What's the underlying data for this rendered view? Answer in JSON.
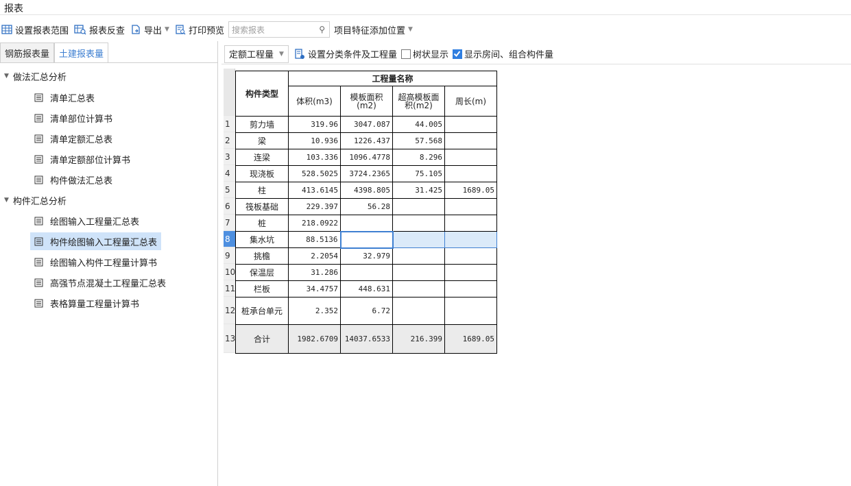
{
  "window": {
    "title": "报表"
  },
  "toolbar": {
    "set_range": "设置报表范围",
    "reverse_check": "报表反查",
    "export": "导出",
    "print_preview": "打印预览",
    "search_placeholder": "搜索报表",
    "feature_position": "项目特征添加位置"
  },
  "tabs": [
    {
      "label": "钢筋报表量",
      "active": false
    },
    {
      "label": "土建报表量",
      "active": true
    }
  ],
  "tree": {
    "groups": [
      {
        "label": "做法汇总分析",
        "items": [
          "清单汇总表",
          "清单部位计算书",
          "清单定额汇总表",
          "清单定额部位计算书",
          "构件做法汇总表"
        ]
      },
      {
        "label": "构件汇总分析",
        "items": [
          "绘图输入工程量汇总表",
          "构件绘图输入工程量汇总表",
          "绘图输入构件工程量计算书",
          "高强节点混凝土工程量汇总表",
          "表格算量工程量计算书"
        ]
      }
    ],
    "selected": "构件绘图输入工程量汇总表"
  },
  "right_toolbar": {
    "quantity_type": "定额工程量",
    "set_conditions": "设置分类条件及工程量",
    "tree_view_label": "树状显示",
    "tree_view_checked": false,
    "show_rooms_label": "显示房间、组合构件量",
    "show_rooms_checked": true
  },
  "table": {
    "header_component": "构件类型",
    "header_group": "工程量名称",
    "columns": [
      "体积(m3)",
      "模板面积(m2)",
      "超高模板面积(m2)",
      "周长(m)"
    ],
    "rows": [
      {
        "n": "1",
        "name": "剪力墙",
        "v": [
          "319.96",
          "3047.087",
          "44.005",
          ""
        ]
      },
      {
        "n": "2",
        "name": "梁",
        "v": [
          "10.936",
          "1226.437",
          "57.568",
          ""
        ]
      },
      {
        "n": "3",
        "name": "连梁",
        "v": [
          "103.336",
          "1096.4778",
          "8.296",
          ""
        ]
      },
      {
        "n": "4",
        "name": "现浇板",
        "v": [
          "528.5025",
          "3724.2365",
          "75.105",
          ""
        ]
      },
      {
        "n": "5",
        "name": "柱",
        "v": [
          "413.6145",
          "4398.805",
          "31.425",
          "1689.05"
        ]
      },
      {
        "n": "6",
        "name": "筏板基础",
        "v": [
          "229.397",
          "56.28",
          "",
          ""
        ]
      },
      {
        "n": "7",
        "name": "桩",
        "v": [
          "218.0922",
          "",
          "",
          ""
        ]
      },
      {
        "n": "8",
        "name": "集水坑",
        "v": [
          "88.5136",
          "",
          "",
          ""
        ]
      },
      {
        "n": "9",
        "name": "挑檐",
        "v": [
          "2.2054",
          "32.979",
          "",
          ""
        ]
      },
      {
        "n": "10",
        "name": "保温层",
        "v": [
          "31.286",
          "",
          "",
          ""
        ]
      },
      {
        "n": "11",
        "name": "栏板",
        "v": [
          "34.4757",
          "448.631",
          "",
          ""
        ]
      },
      {
        "n": "12",
        "name": "桩承台单元",
        "v": [
          "2.352",
          "6.72",
          "",
          ""
        ]
      },
      {
        "n": "13",
        "name": "合计",
        "v": [
          "1982.6709",
          "14037.6533",
          "216.399",
          "1689.05"
        ]
      }
    ],
    "selected_row": "8"
  }
}
